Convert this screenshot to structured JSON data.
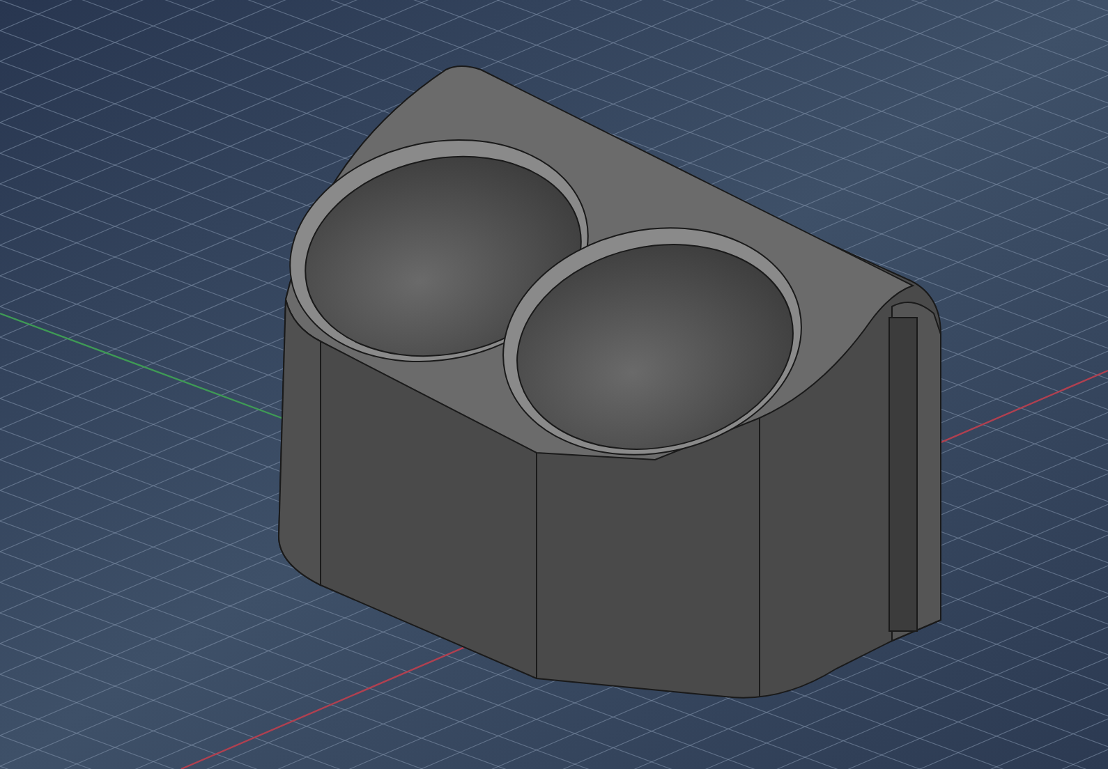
{
  "viewport": {
    "grid": true,
    "axes": true,
    "model": {
      "kind": "solid"
    }
  }
}
